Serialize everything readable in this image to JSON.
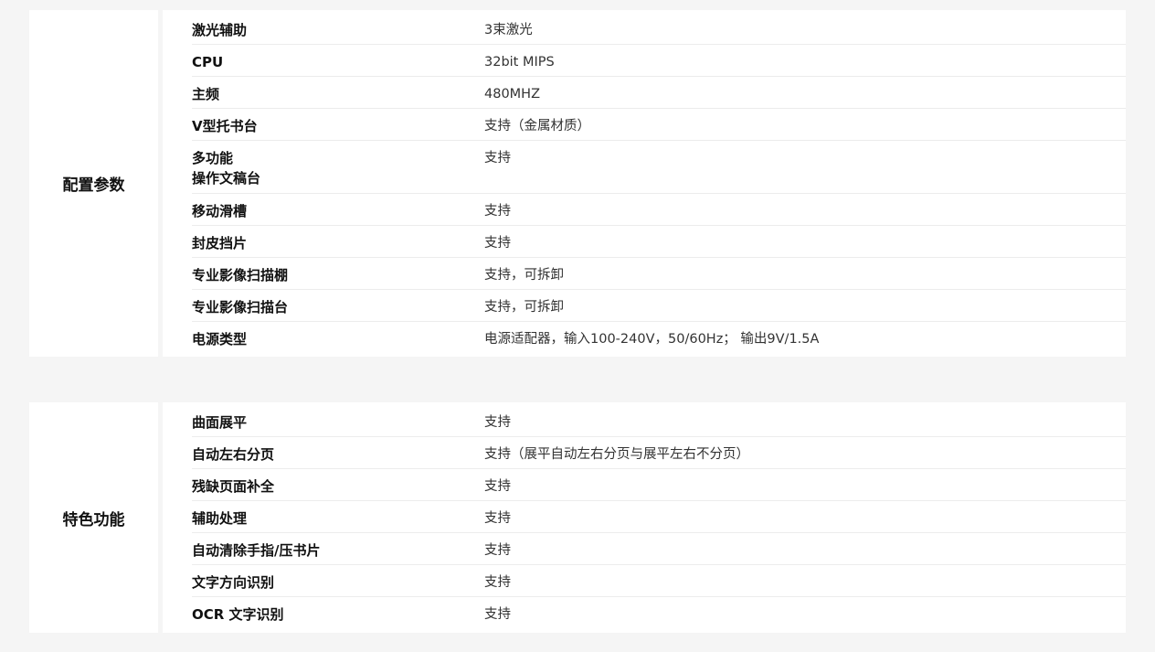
{
  "sections": [
    {
      "category": "配置参数",
      "rows": [
        {
          "label": "激光辅助",
          "value": "3束激光"
        },
        {
          "label": "CPU",
          "value": "32bit MIPS"
        },
        {
          "label": "主频",
          "value": "480MHZ"
        },
        {
          "label": "V型托书台",
          "value": "支持（金属材质）"
        },
        {
          "label": "多功能\n操作文稿台",
          "value": "支持"
        },
        {
          "label": "移动滑槽",
          "value": "支持"
        },
        {
          "label": "封皮挡片",
          "value": "支持"
        },
        {
          "label": "专业影像扫描棚",
          "value": "支持，可拆卸"
        },
        {
          "label": "专业影像扫描台",
          "value": "支持，可拆卸"
        },
        {
          "label": "电源类型",
          "value": "电源适配器，输入100-240V，50/60Hz； 输出9V/1.5A"
        }
      ]
    },
    {
      "category": "特色功能",
      "rows": [
        {
          "label": "曲面展平",
          "value": "支持"
        },
        {
          "label": "自动左右分页",
          "value": "支持（展平自动左右分页与展平左右不分页）"
        },
        {
          "label": "残缺页面补全",
          "value": "支持"
        },
        {
          "label": "辅助处理",
          "value": "支持"
        },
        {
          "label": "自动清除手指/压书片",
          "value": "支持"
        },
        {
          "label": "文字方向识别",
          "value": "支持"
        },
        {
          "label": "OCR 文字识别",
          "value": "支持"
        }
      ]
    }
  ]
}
